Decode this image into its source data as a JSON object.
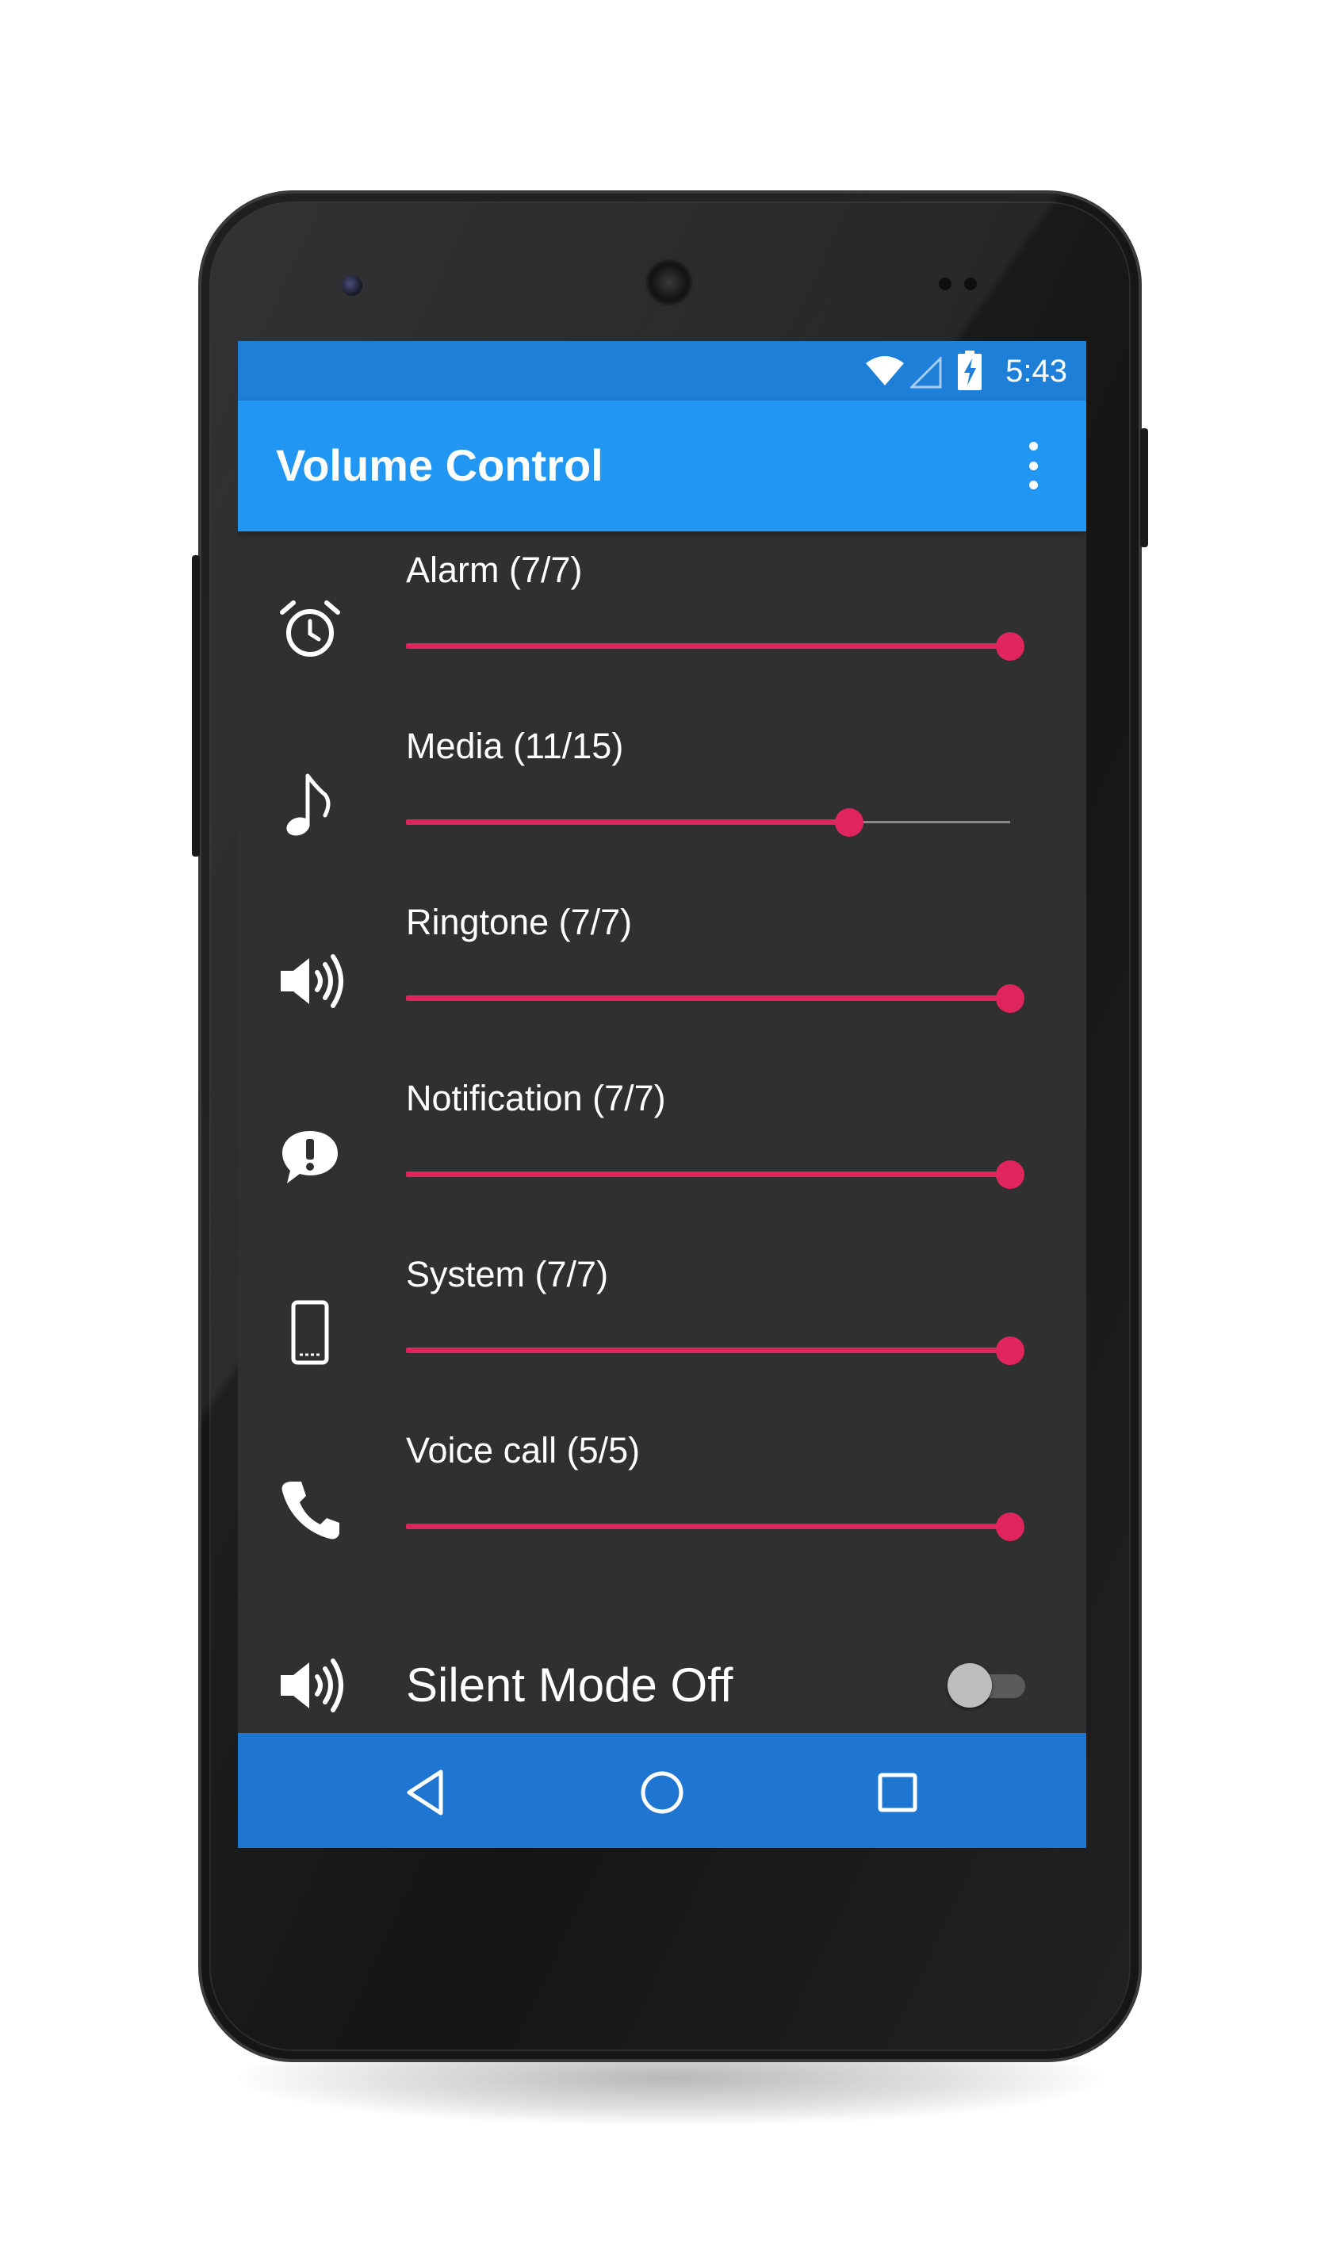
{
  "status_bar": {
    "time": "5:43",
    "icons": [
      "wifi-icon",
      "cell-signal-icon",
      "battery-charging-icon"
    ]
  },
  "app_bar": {
    "title": "Volume Control",
    "overflow_icon": "more-vert-icon"
  },
  "volume_rows": [
    {
      "id": "alarm",
      "icon": "alarm-clock-icon",
      "label": "Alarm (7/7)",
      "level": 7,
      "max": 7
    },
    {
      "id": "media",
      "icon": "music-note-icon",
      "label": "Media (11/15)",
      "level": 11,
      "max": 15
    },
    {
      "id": "ringtone",
      "icon": "speaker-volume-icon",
      "label": "Ringtone (7/7)",
      "level": 7,
      "max": 7
    },
    {
      "id": "notification",
      "icon": "chat-alert-icon",
      "label": "Notification (7/7)",
      "level": 7,
      "max": 7
    },
    {
      "id": "system",
      "icon": "phone-device-icon",
      "label": "System (7/7)",
      "level": 7,
      "max": 7
    },
    {
      "id": "voice_call",
      "icon": "phone-handset-icon",
      "label": "Voice call (5/5)",
      "level": 5,
      "max": 5
    }
  ],
  "silent_mode": {
    "icon": "speaker-volume-icon",
    "label": "Silent Mode Off",
    "enabled": false
  },
  "nav_bar": {
    "buttons": [
      "back-icon",
      "home-icon",
      "recents-icon"
    ]
  },
  "colors": {
    "accent": "#e0245e",
    "primary": "#2196f3",
    "primary_dark": "#1e7fd9",
    "background": "#303030"
  }
}
